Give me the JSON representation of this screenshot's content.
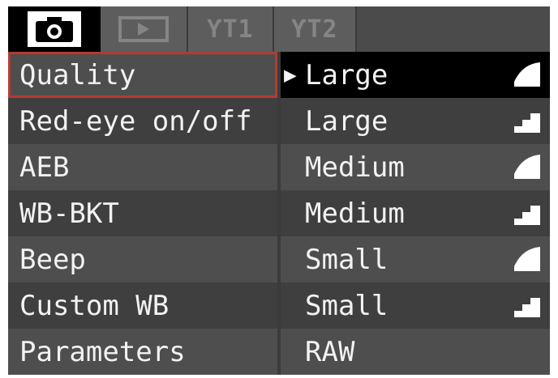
{
  "tabs": [
    {
      "id": "shoot",
      "icon": "camera-icon",
      "active": true
    },
    {
      "id": "play",
      "icon": "playback-icon",
      "active": false
    },
    {
      "id": "setup1",
      "label": "ƳT1",
      "active": false
    },
    {
      "id": "setup2",
      "label": "ƳT2",
      "active": false
    }
  ],
  "menu_items": [
    {
      "label": "Quality",
      "selected": true
    },
    {
      "label": "Red-eye on/off"
    },
    {
      "label": "AEB"
    },
    {
      "label": "WB-BKT"
    },
    {
      "label": "Beep"
    },
    {
      "label": "Custom WB"
    },
    {
      "label": "Parameters"
    }
  ],
  "quality_options": [
    {
      "label": "Large",
      "icon": "fine-quality-icon",
      "current": true
    },
    {
      "label": "Large",
      "icon": "normal-quality-icon"
    },
    {
      "label": "Medium",
      "icon": "fine-quality-icon"
    },
    {
      "label": "Medium",
      "icon": "normal-quality-icon"
    },
    {
      "label": "Small",
      "icon": "fine-quality-icon"
    },
    {
      "label": "Small",
      "icon": "normal-quality-icon"
    },
    {
      "label": "RAW",
      "icon": ""
    }
  ],
  "colors": {
    "background": "#4b4b4b",
    "highlight": "#000000",
    "selection_outline": "#b53a34",
    "text": "#f2f2f2"
  }
}
